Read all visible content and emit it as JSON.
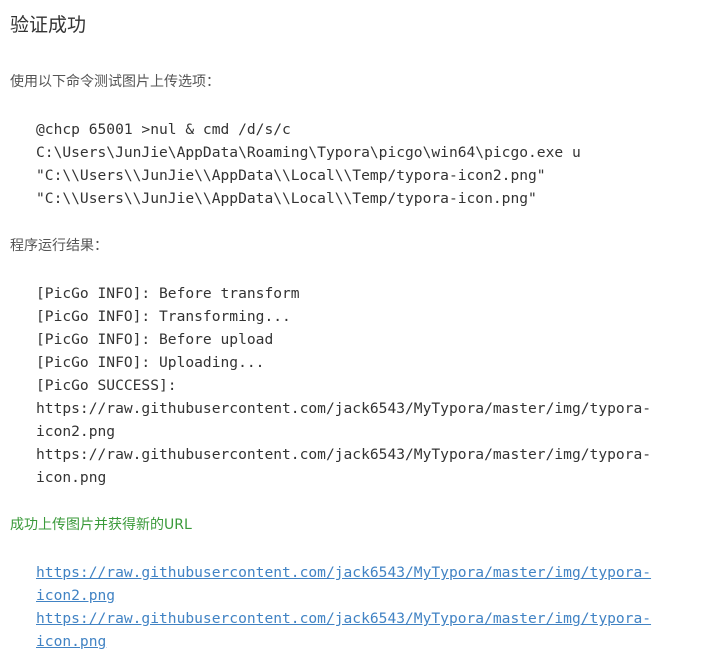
{
  "title": "验证成功",
  "usage_note": "使用以下命令测试图片上传选项：",
  "command_lines": [
    "@chcp 65001 >nul & cmd /d/s/c",
    "C:\\Users\\JunJie\\AppData\\Roaming\\Typora\\picgo\\win64\\picgo.exe u",
    "\"C:\\\\Users\\\\JunJie\\\\AppData\\\\Local\\\\Temp/typora-icon2.png\"",
    "\"C:\\\\Users\\\\JunJie\\\\AppData\\\\Local\\\\Temp/typora-icon.png\""
  ],
  "result_note": "程序运行结果：",
  "output_lines": [
    "[PicGo INFO]: Before transform",
    "[PicGo INFO]: Transforming...",
    "[PicGo INFO]: Before upload",
    "[PicGo INFO]: Uploading...",
    "[PicGo SUCCESS]:",
    "https://raw.githubusercontent.com/jack6543/MyTypora/master/img/typora-",
    "icon2.png",
    "https://raw.githubusercontent.com/jack6543/MyTypora/master/img/typora-",
    "icon.png"
  ],
  "success_note": "成功上传图片并获得新的URL",
  "url_lines": [
    "https://raw.githubusercontent.com/jack6543/MyTypora/master/img/typora-",
    "icon2.png",
    "https://raw.githubusercontent.com/jack6543/MyTypora/master/img/typora-",
    "icon.png"
  ],
  "colors": {
    "success_text": "#3a9a3a",
    "link": "#4183c4",
    "body_text": "#333333"
  }
}
